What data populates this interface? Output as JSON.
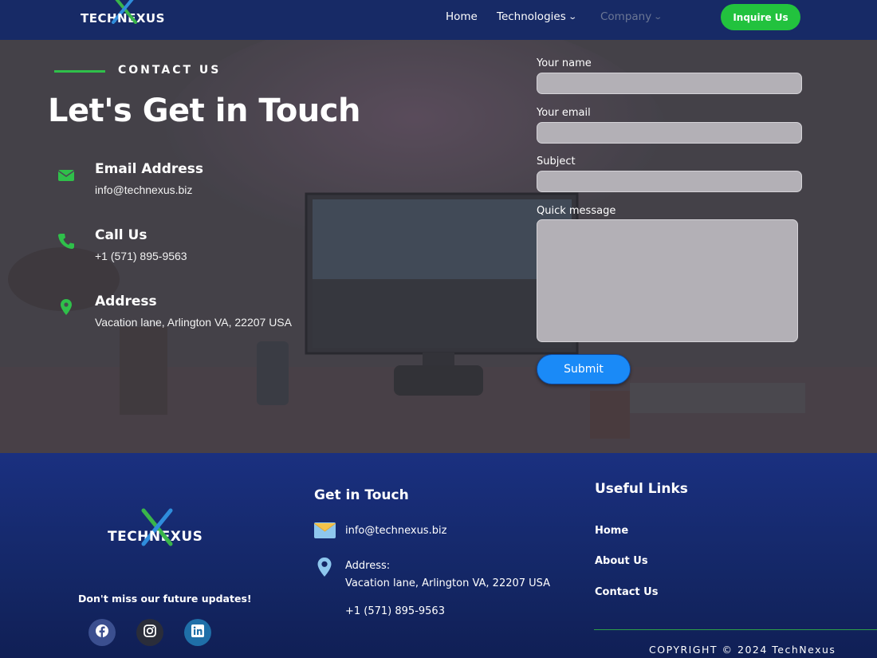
{
  "brand": {
    "logo_left": "TECH",
    "logo_mid": "N",
    "logo_right": "EXUS"
  },
  "nav": {
    "links": [
      {
        "label": "Home"
      },
      {
        "label": "Technologies"
      },
      {
        "label": "Company"
      }
    ],
    "cta_label": "Inquire Us"
  },
  "hero": {
    "eyebrow": "CONTACT US",
    "headline": "Let's Get in Touch",
    "info": [
      {
        "title": "Email Address",
        "text": "info@technexus.biz",
        "icon": "envelope-icon"
      },
      {
        "title": "Call Us",
        "text": "+1 (571) 895-9563",
        "icon": "phone-icon"
      },
      {
        "title": "Address",
        "text": "Vacation lane, Arlington VA, 22207 USA",
        "icon": "map-pin-icon"
      }
    ]
  },
  "form": {
    "name_label": "Your name",
    "email_label": "Your email",
    "subject_label": "Subject",
    "message_label": "Quick message",
    "name_value": "",
    "email_value": "",
    "subject_value": "",
    "message_value": "",
    "submit_label": "Submit"
  },
  "footer": {
    "updates_text": "Don't miss our future updates!",
    "social": [
      "facebook-icon",
      "instagram-icon",
      "linkedin-icon"
    ],
    "get_in_touch_title": "Get in Touch",
    "email": "info@technexus.biz",
    "address_label": "Address:",
    "address": "Vacation lane, Arlington VA, 22207 USA",
    "phone": "+1 (571) 895-9563",
    "useful_links_title": "Useful Links",
    "links": [
      {
        "label": "Home"
      },
      {
        "label": "About Us"
      },
      {
        "label": "Contact Us"
      }
    ],
    "copyright": "COPYRIGHT © 2024 TechNexus"
  },
  "colors": {
    "nav_bg": "#172a66",
    "accent_green": "#22c23e",
    "submit_blue": "#1a8af7",
    "footer_bg": "#142766"
  }
}
